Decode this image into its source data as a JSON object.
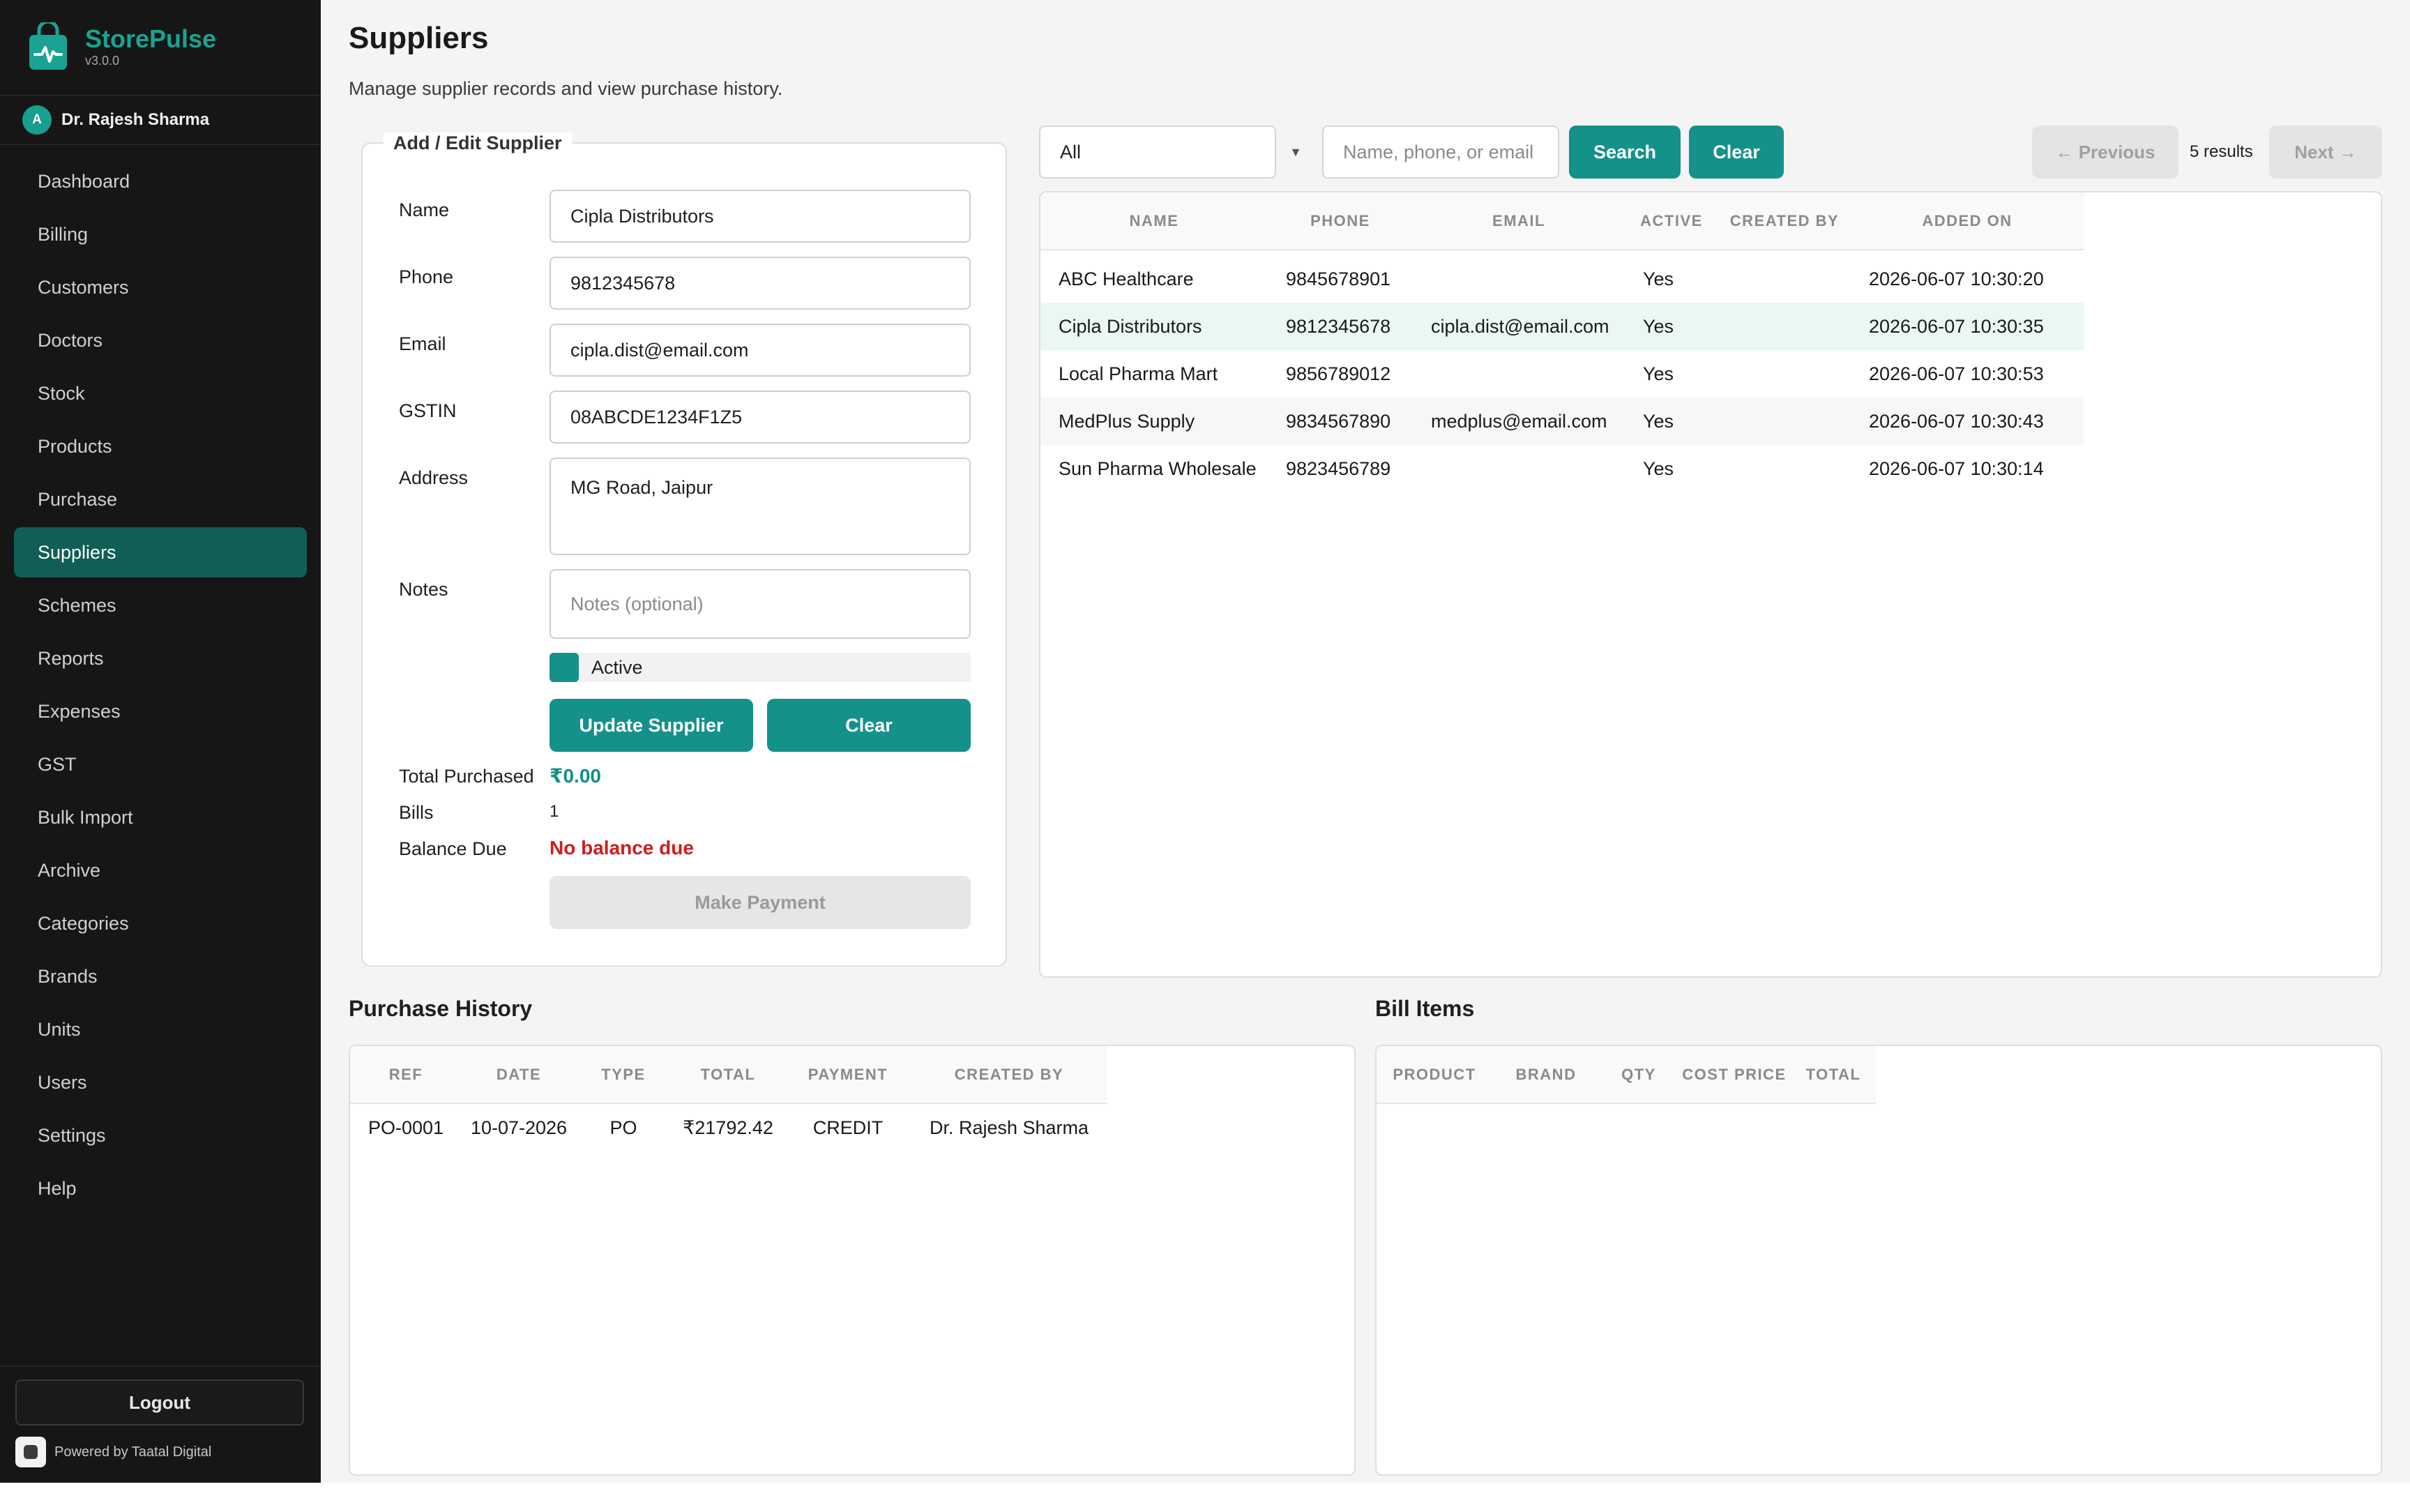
{
  "brand": {
    "name": "StorePulse",
    "version": "v3.0.0"
  },
  "user": {
    "initial": "A",
    "name": "Dr. Rajesh Sharma"
  },
  "nav": [
    {
      "label": "Dashboard"
    },
    {
      "label": "Billing"
    },
    {
      "label": "Customers"
    },
    {
      "label": "Doctors"
    },
    {
      "label": "Stock"
    },
    {
      "label": "Products"
    },
    {
      "label": "Purchase"
    },
    {
      "label": "Suppliers",
      "active": true
    },
    {
      "label": "Schemes"
    },
    {
      "label": "Reports"
    },
    {
      "label": "Expenses"
    },
    {
      "label": "GST"
    },
    {
      "label": "Bulk Import"
    },
    {
      "label": "Archive"
    },
    {
      "label": "Categories"
    },
    {
      "label": "Brands"
    },
    {
      "label": "Units"
    },
    {
      "label": "Users"
    },
    {
      "label": "Settings"
    },
    {
      "label": "Help"
    }
  ],
  "footer": {
    "logout": "Logout",
    "powered": "Powered by Taatal Digital"
  },
  "page": {
    "title": "Suppliers",
    "subtitle": "Manage supplier records and view purchase history."
  },
  "form": {
    "legend": "Add / Edit Supplier",
    "labels": {
      "name": "Name",
      "phone": "Phone",
      "email": "Email",
      "gstin": "GSTIN",
      "address": "Address",
      "notes": "Notes"
    },
    "values": {
      "name": "Cipla Distributors",
      "phone": "9812345678",
      "email": "cipla.dist@email.com",
      "gstin": "08ABCDE1234F1Z5",
      "address": "MG Road, Jaipur"
    },
    "notes_placeholder": "Notes (optional)",
    "active_label": "Active",
    "active_checked": true,
    "update_button": "Update Supplier",
    "clear_button": "Clear",
    "stats": {
      "total_purchased_label": "Total Purchased",
      "total_purchased": "₹0.00",
      "bills_label": "Bills",
      "bills": "1",
      "balance_label": "Balance Due",
      "balance": "No balance due"
    },
    "make_payment": "Make Payment"
  },
  "toolbar": {
    "filter_value": "All",
    "search_placeholder": "Name, phone, or email",
    "search_button": "Search",
    "clear_button": "Clear",
    "previous": "← Previous",
    "results": "5 results",
    "next": "Next →"
  },
  "suppliers": {
    "columns": [
      "NAME",
      "PHONE",
      "EMAIL",
      "ACTIVE",
      "CREATED BY",
      "ADDED ON"
    ],
    "rows": [
      {
        "name": "ABC Healthcare",
        "phone": "9845678901",
        "email": "",
        "active": "Yes",
        "created_by": "",
        "added_on": "2026-06-07 10:30:20"
      },
      {
        "name": "Cipla Distributors",
        "phone": "9812345678",
        "email": "cipla.dist@email.com",
        "active": "Yes",
        "created_by": "",
        "added_on": "2026-06-07 10:30:35"
      },
      {
        "name": "Local Pharma Mart",
        "phone": "9856789012",
        "email": "",
        "active": "Yes",
        "created_by": "",
        "added_on": "2026-06-07 10:30:53"
      },
      {
        "name": "MedPlus Supply",
        "phone": "9834567890",
        "email": "medplus@email.com",
        "active": "Yes",
        "created_by": "",
        "added_on": "2026-06-07 10:30:43"
      },
      {
        "name": "Sun Pharma Wholesale",
        "phone": "9823456789",
        "email": "",
        "active": "Yes",
        "created_by": "",
        "added_on": "2026-06-07 10:30:14"
      }
    ]
  },
  "history": {
    "title": "Purchase History",
    "columns": [
      "REF",
      "DATE",
      "TYPE",
      "TOTAL",
      "PAYMENT",
      "CREATED BY"
    ],
    "rows": [
      {
        "ref": "PO-0001",
        "date": "10-07-2026",
        "type": "PO",
        "total": "₹21792.42",
        "payment": "CREDIT",
        "created_by": "Dr. Rajesh Sharma"
      }
    ]
  },
  "bill_items": {
    "title": "Bill Items",
    "columns": [
      "PRODUCT",
      "BRAND",
      "QTY",
      "COST PRICE",
      "TOTAL"
    ]
  },
  "colors": {
    "accent": "#14918a",
    "sidebar": "#161616",
    "active_nav": "#115e56",
    "danger": "#d11c1c"
  }
}
